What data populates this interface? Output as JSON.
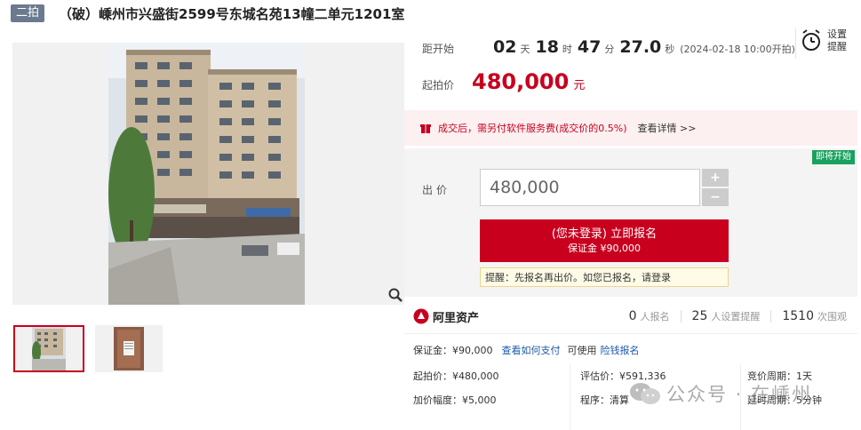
{
  "header": {
    "badge": "二拍",
    "title": "（破）嵊州市兴盛街2599号东城名苑13幢二单元1201室"
  },
  "gallery": {
    "main_alt": "building photo",
    "zoom_icon": "magnifier-icon",
    "thumbnails": [
      "building-photo",
      "notice-photo"
    ]
  },
  "countdown": {
    "label": "距开始",
    "days": "02",
    "days_unit": "天",
    "hours": "18",
    "hours_unit": "时",
    "minutes": "47",
    "minutes_unit": "分",
    "seconds": "27.0",
    "seconds_unit": "秒",
    "start_time": "(2024-02-18 10:00开拍)"
  },
  "remind": {
    "icon": "alarm-clock-icon",
    "label": "设置提醒"
  },
  "start_price": {
    "label": "起拍价",
    "value": "480,000",
    "unit": "元"
  },
  "notice": {
    "text": "成交后，需另付软件服务费(成交价的0.5%)",
    "link": "查看详情 >>"
  },
  "bid": {
    "status_tag": "即将开始",
    "label": "出价",
    "value": "480,000",
    "plus": "+",
    "minus": "−",
    "register_line1": "(您未登录) 立即报名",
    "register_line2": "保证金 ¥90,000",
    "tip": "提醒：先报名再出价。如您已报名，请登录"
  },
  "platform": {
    "name": "阿里资产",
    "stats": [
      {
        "n": "0",
        "l": "人报名"
      },
      {
        "n": "25",
        "l": "人设置提醒"
      },
      {
        "n": "1510",
        "l": "次围观"
      }
    ]
  },
  "deposit": {
    "text": "保证金：¥90,000",
    "link1": "查看如何支付",
    "mid": "可使用",
    "link2": "险钱报名"
  },
  "details": {
    "start_price": "起拍价：¥480,000",
    "increment": "加价幅度：¥5,000",
    "appraisal": "评估价：¥591,336",
    "procedure": "程序：清算",
    "cycle": "竞价周期：1天",
    "delay": "延时周期：5分钟"
  },
  "watermark": {
    "text": "公众号 · 在嵊州"
  },
  "colors": {
    "accent_red": "#c8001e",
    "badge_gray": "#6b7a8f",
    "status_green": "#19a15f",
    "link_blue": "#1d5aa8"
  }
}
